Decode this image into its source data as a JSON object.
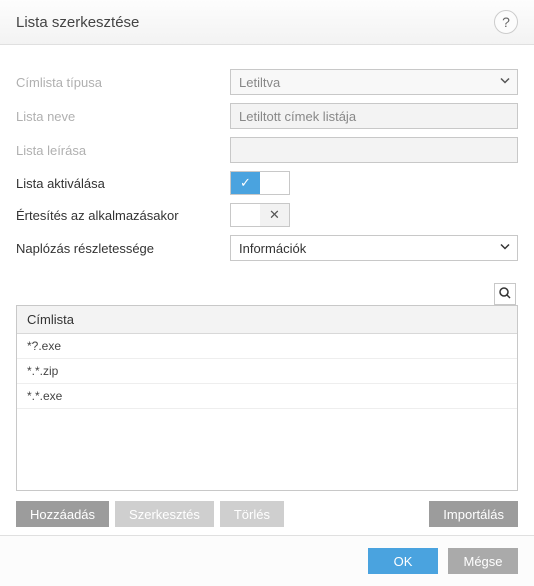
{
  "header": {
    "title": "Lista szerkesztése"
  },
  "form": {
    "list_type": {
      "label": "Címlista típusa",
      "value": "Letiltva"
    },
    "list_name": {
      "label": "Lista neve",
      "value": "Letiltott címek listája"
    },
    "list_desc": {
      "label": "Lista leírása",
      "value": ""
    },
    "list_active": {
      "label": "Lista aktiválása",
      "state": "on"
    },
    "notify_apply": {
      "label": "Értesítés az alkalmazásakor",
      "state": "off"
    },
    "log_severity": {
      "label": "Naplózás részletessége",
      "value": "Információk"
    }
  },
  "table": {
    "header": "Címlista",
    "rows": [
      "*?.exe",
      "*.*.zip",
      "*.*.exe"
    ]
  },
  "actions": {
    "add": "Hozzáadás",
    "edit": "Szerkesztés",
    "delete": "Törlés",
    "import": "Importálás"
  },
  "footer": {
    "ok": "OK",
    "cancel": "Mégse"
  }
}
